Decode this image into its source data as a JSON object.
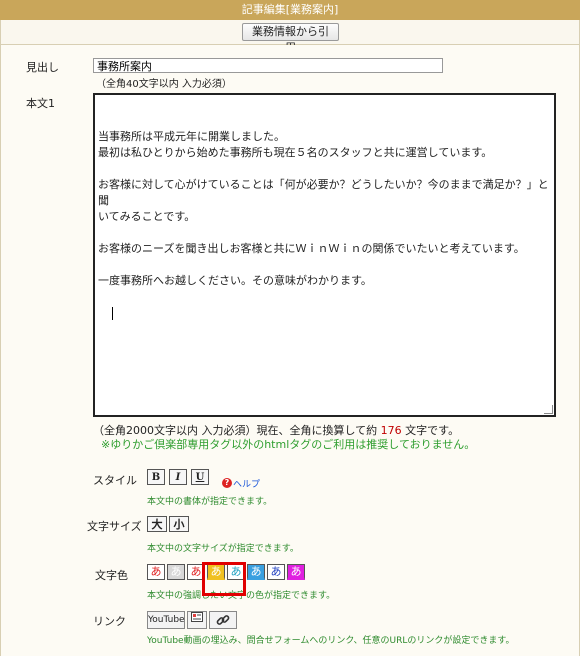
{
  "window": {
    "title": "記事編集[業務案内]"
  },
  "toolbar": {
    "import_label": "業務情報から引用"
  },
  "form": {
    "heading_label": "見出し",
    "heading_value": "事務所案内",
    "heading_note": "（全角40文字以内 入力必須）",
    "body_label": "本文1",
    "body_lines": [
      "当事務所は平成元年に開業しました。",
      "最初は私ひとりから始めた事務所も現在５名のスタッフと共に運営しています。",
      "",
      "お客様に対して心がけていることは「何が必要か？どうしたいか？今のままで満足か？」と聞",
      "いてみることです。",
      "",
      "お客様のニーズを聞き出しお客様と共にＷｉｎＷｉｎの関係でいたいと考えています。",
      "",
      "一度事務所へお越しください。その意味がわかります。"
    ],
    "body_note_prefix": "（全角2000文字以内 入力必須）現在、全角に換算して約",
    "body_count": "176",
    "body_note_suffix": "文字です。",
    "warning": "※ゆりかご倶楽部専用タグ以外のhtmlタグのご利用は推奨しておりません。"
  },
  "style_row": {
    "label": "スタイル",
    "buttons": [
      "B",
      "I",
      "U"
    ],
    "help_label": "ヘルプ",
    "note": "本文中の書体が指定できます。"
  },
  "size_row": {
    "label": "文字サイズ",
    "buttons": [
      "大",
      "小"
    ],
    "note": "本文中の文字サイズが指定できます。"
  },
  "color_row": {
    "label": "文字色",
    "swatch_char": "あ",
    "swatches": [
      {
        "bg": "#ffffff",
        "fg": "#e02020"
      },
      {
        "bg": "#d8d8d8",
        "fg": "#ffffff"
      },
      {
        "bg": "#ffffff",
        "fg": "#e02020"
      },
      {
        "bg": "#f0c020",
        "fg": "#f0c020"
      },
      {
        "bg": "#ffffff",
        "fg": "#20a0c0"
      },
      {
        "bg": "#3aa0e0",
        "fg": "#3aa0e0"
      },
      {
        "bg": "#ffffff",
        "fg": "#2040c0"
      },
      {
        "bg": "#e020e0",
        "fg": "#e020e0"
      }
    ],
    "note": "本文中の強調したい文字の色が指定できます。"
  },
  "link_row": {
    "label": "リンク",
    "youtube_label": "YouTube",
    "note": "YouTube動画の埋込み、問合せフォームへのリンク、任意のURLのリンクが設定できます。"
  }
}
